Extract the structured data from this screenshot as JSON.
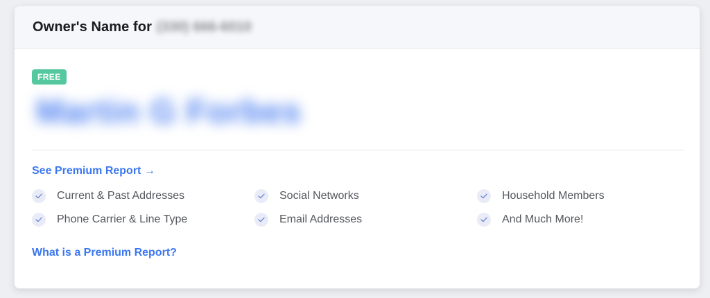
{
  "header": {
    "title": "Owner's Name for",
    "phone": "(330) 666-6010"
  },
  "badge": {
    "label": "FREE",
    "color": "#56c8a0"
  },
  "owner": {
    "name": "Martin G Forbes"
  },
  "premium_link": {
    "label": "See Premium Report →"
  },
  "features": [
    {
      "label": "Current & Past Addresses",
      "icon": "check-icon"
    },
    {
      "label": "Social Networks",
      "icon": "check-icon"
    },
    {
      "label": "Household Members",
      "icon": "check-icon"
    },
    {
      "label": "Phone Carrier & Line Type",
      "icon": "check-icon"
    },
    {
      "label": "Email Addresses",
      "icon": "check-icon"
    },
    {
      "label": "And Much More!",
      "icon": "check-icon"
    }
  ],
  "what_link": {
    "label": "What is a Premium Report?"
  },
  "colors": {
    "accent": "#3a77f0",
    "name_blur": "#4a7ef0",
    "check_bg": "#e9ecf6"
  }
}
